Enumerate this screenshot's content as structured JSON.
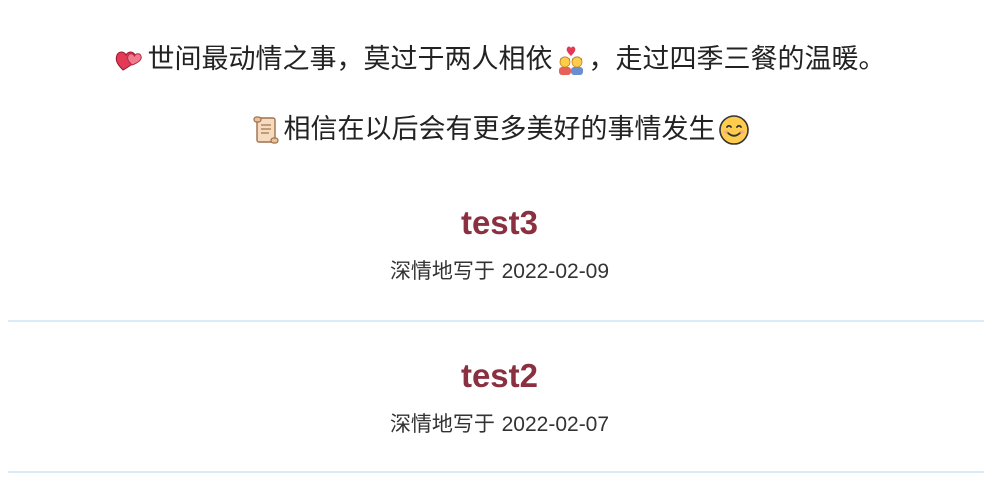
{
  "intro": {
    "line1_text": "世间最动情之事，莫过于两人相依",
    "line1_suffix": "，走过四季三餐的温暖。",
    "line2_text": "相信在以后会有更多美好的事情发生"
  },
  "icons": {
    "line1_start": "two-hearts-icon",
    "line1_middle": "couple-with-heart-icon",
    "line2_start": "scroll-icon",
    "line2_end": "smiling-face-icon"
  },
  "colors": {
    "title": "#8b3040",
    "divider": "#dbeaf7",
    "text": "#333333"
  },
  "posts": [
    {
      "title": "test3",
      "meta_prefix": "深情地写于",
      "date": "2022-02-09"
    },
    {
      "title": "test2",
      "meta_prefix": "深情地写于",
      "date": "2022-02-07"
    }
  ]
}
